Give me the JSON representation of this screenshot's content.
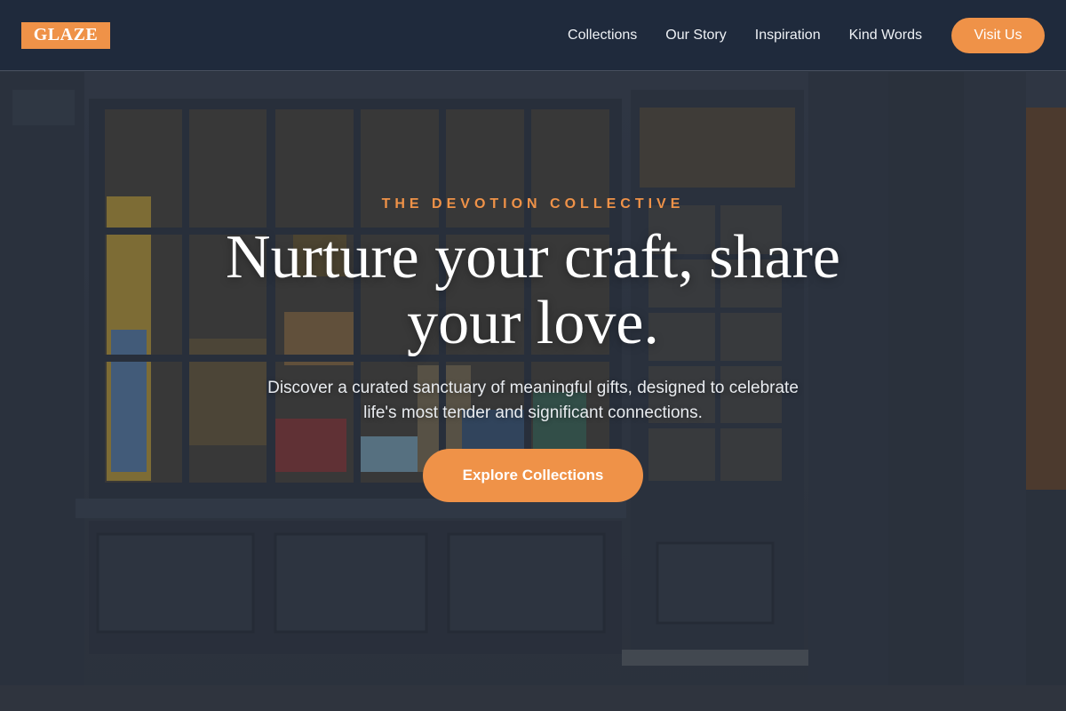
{
  "brand": {
    "logo_text": "GLAZE",
    "accent_color": "#ef9248",
    "nav_bg": "#1f2a3c"
  },
  "nav": {
    "links": [
      "Collections",
      "Our Story",
      "Inspiration",
      "Kind Words"
    ],
    "cta_label": "Visit Us"
  },
  "hero": {
    "eyebrow": "THE DEVOTION COLLECTIVE",
    "headline": "Nurture your craft, share your love.",
    "subtext": "Discover a curated sanctuary of meaningful gifts, designed to celebrate life's most tender and significant connections.",
    "cta_label": "Explore Collections",
    "background": "storefront-photo"
  }
}
